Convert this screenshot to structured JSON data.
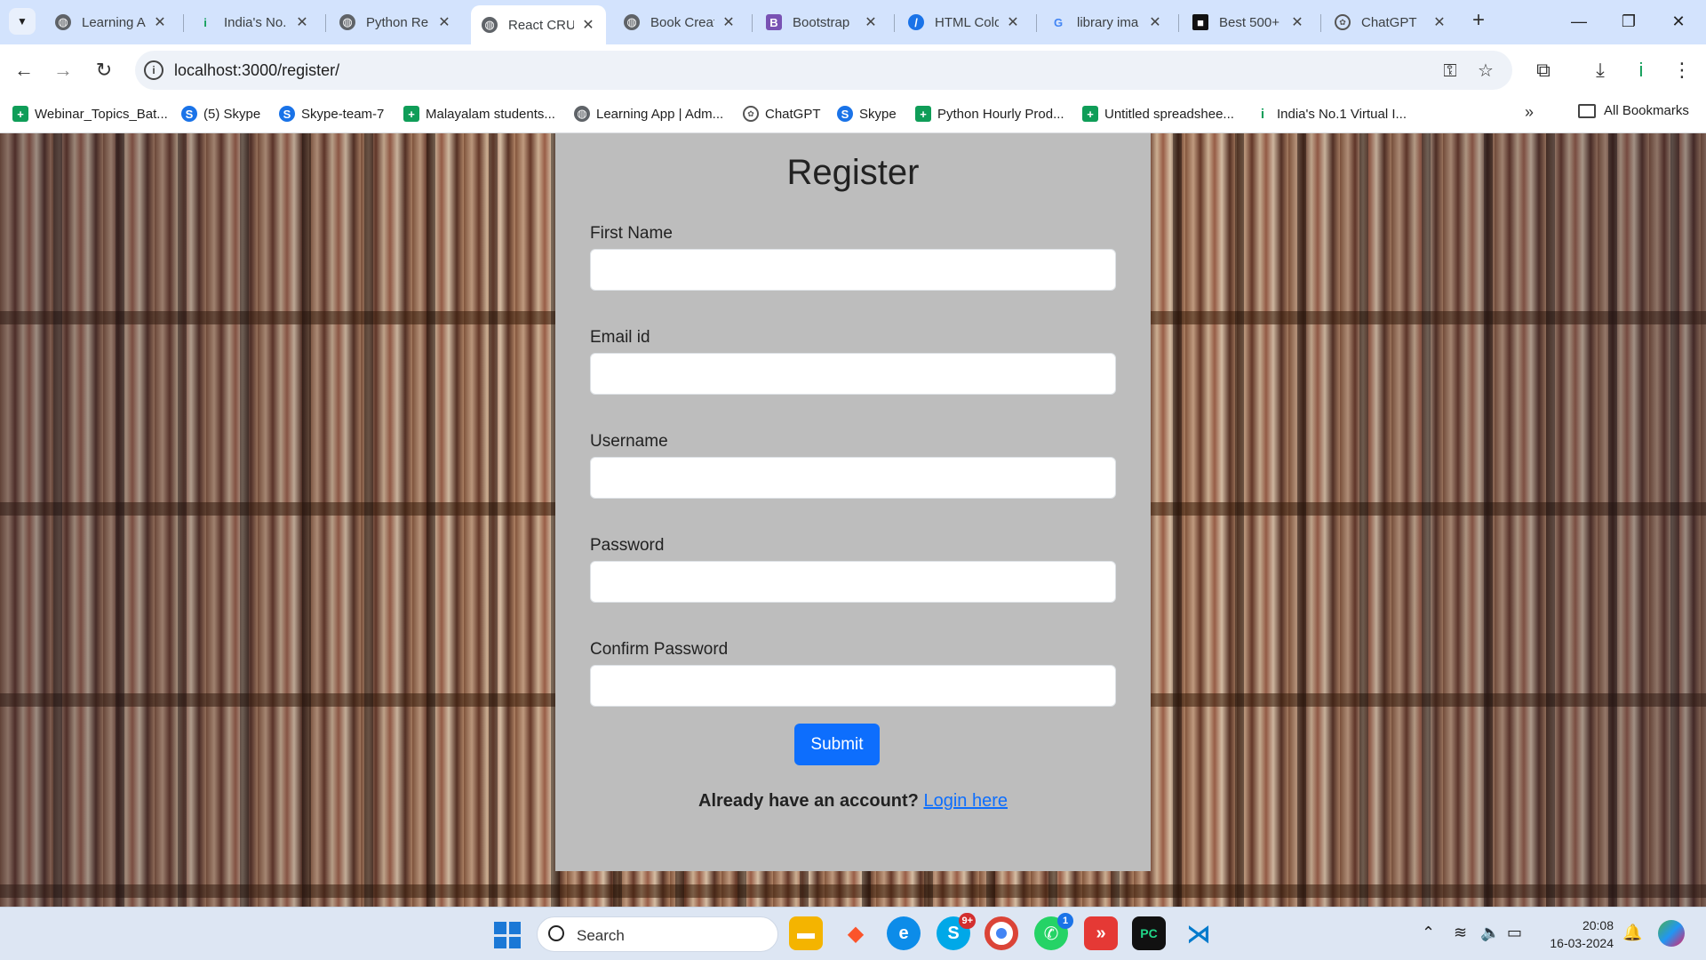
{
  "browser": {
    "tabs": [
      {
        "title": "Learning A",
        "icon": "globe-icon"
      },
      {
        "title": "India's No.",
        "icon": "indeed-icon"
      },
      {
        "title": "Python Re",
        "icon": "globe-icon"
      },
      {
        "title": "React CRU",
        "icon": "globe-icon",
        "active": true
      },
      {
        "title": "Book Creat",
        "icon": "globe-icon"
      },
      {
        "title": "Bootstrap",
        "icon": "bootstrap-icon"
      },
      {
        "title": "HTML Colo",
        "icon": "colorcodes-icon"
      },
      {
        "title": "library ima",
        "icon": "google-icon"
      },
      {
        "title": "Best 500+",
        "icon": "unsplash-icon"
      },
      {
        "title": "ChatGPT",
        "icon": "chatgpt-icon"
      }
    ],
    "url": "localhost:3000/register/",
    "bookmarks": [
      {
        "label": "Webinar_Topics_Bat...",
        "icon": "sheets-icon"
      },
      {
        "label": "(5) Skype",
        "icon": "skype-icon"
      },
      {
        "label": "Skype-team-7",
        "icon": "skype-icon"
      },
      {
        "label": "Malayalam students...",
        "icon": "sheets-icon"
      },
      {
        "label": "Learning App | Adm...",
        "icon": "globe-icon"
      },
      {
        "label": "ChatGPT",
        "icon": "chatgpt-icon"
      },
      {
        "label": "Skype",
        "icon": "skype-icon"
      },
      {
        "label": "Python Hourly Prod...",
        "icon": "sheets-icon"
      },
      {
        "label": "Untitled spreadshee...",
        "icon": "sheets-icon"
      },
      {
        "label": "India's No.1 Virtual I...",
        "icon": "indeed-icon"
      }
    ],
    "all_bookmarks": "All Bookmarks"
  },
  "form": {
    "title": "Register",
    "fields": [
      {
        "label": "First Name",
        "value": ""
      },
      {
        "label": "Email id",
        "value": ""
      },
      {
        "label": "Username",
        "value": ""
      },
      {
        "label": "Password",
        "value": ""
      },
      {
        "label": "Confirm Password",
        "value": ""
      }
    ],
    "submit_label": "Submit",
    "account_prompt": "Already have an account?",
    "login_link": "Login here"
  },
  "taskbar": {
    "search_label": "Search",
    "skype_badge": "9+",
    "whatsapp_badge": "1",
    "time": "20:08",
    "date": "16-03-2024"
  },
  "colors": {
    "tab_strip": "#d3e3fd",
    "card_bg": "#bdbdbd",
    "submit_bg": "#0d6efd",
    "link": "#0d6efd"
  }
}
